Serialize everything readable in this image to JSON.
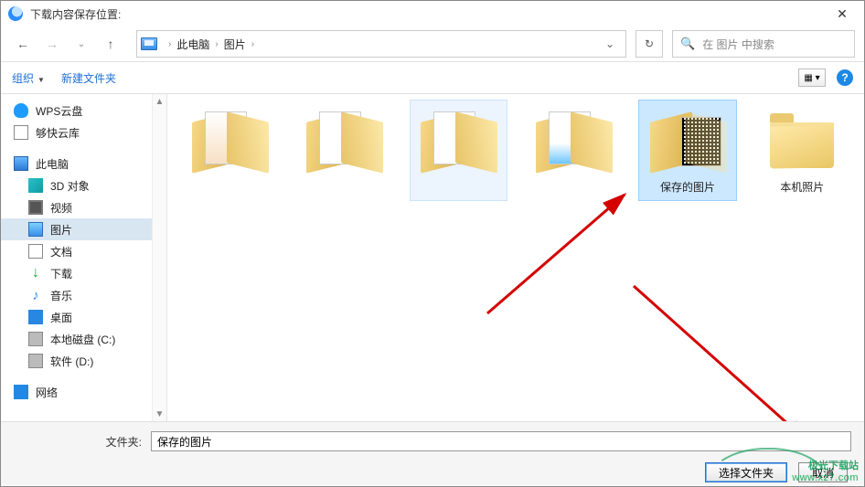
{
  "window": {
    "title": "下载内容保存位置:"
  },
  "nav": {
    "crumbs": [
      "此电脑",
      "图片"
    ],
    "search_placeholder": "在 图片 中搜索"
  },
  "toolbar": {
    "organize": "组织",
    "new_folder": "新建文件夹"
  },
  "help": "?",
  "tree": {
    "wps": "WPS云盘",
    "gk": "够快云库",
    "pc": "此电脑",
    "threeD": "3D 对象",
    "video": "视频",
    "pictures": "图片",
    "docs": "文档",
    "downloads": "下载",
    "music": "音乐",
    "desktop": "桌面",
    "diskC": "本地磁盘 (C:)",
    "diskD": "软件 (D:)",
    "network": "网络"
  },
  "items": {
    "f1": "",
    "f2": "",
    "f3": "",
    "f4": "",
    "f5": "保存的图片",
    "f6": "本机照片"
  },
  "footer": {
    "label": "文件夹:",
    "value": "保存的图片",
    "select": "选择文件夹",
    "cancel": "取消"
  },
  "watermark": {
    "line1": "极光下载站",
    "line2": "www.xz7.com"
  }
}
